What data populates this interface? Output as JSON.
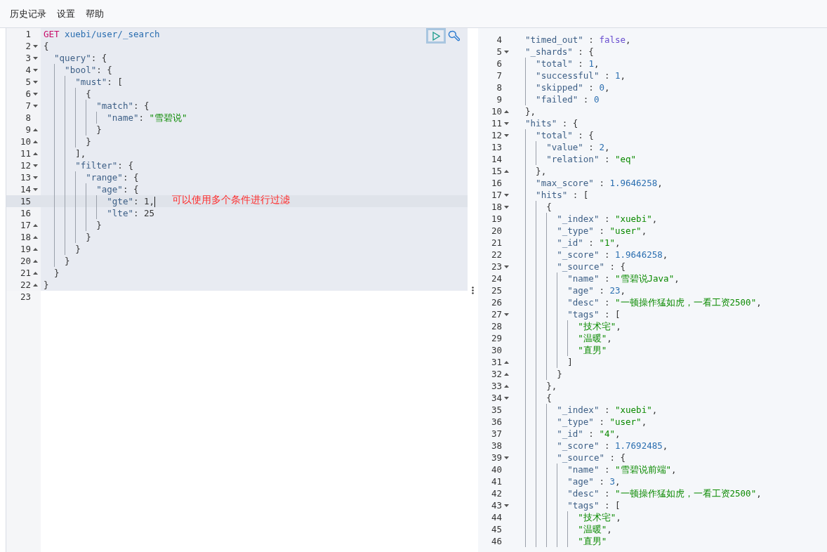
{
  "menu": [
    {
      "label": "历史记录"
    },
    {
      "label": "设置"
    },
    {
      "label": "帮助"
    }
  ],
  "request_editor": {
    "lines": [
      {
        "n": "1",
        "fold_start": false,
        "fold_end": false,
        "highlighted": true,
        "active": false,
        "segs": [
          {
            "kind": "method",
            "text": "GET"
          },
          {
            "kind": "path",
            "text": " xuebi/user/_search"
          }
        ]
      },
      {
        "n": "2",
        "fold_start": true,
        "fold_end": false,
        "highlighted": true,
        "active": false,
        "segs": [
          {
            "kind": "punct",
            "text": "{"
          }
        ]
      },
      {
        "n": "3",
        "fold_start": true,
        "fold_end": false,
        "highlighted": true,
        "active": false,
        "segs": [
          {
            "kind": "key",
            "text": "  \"query\""
          },
          {
            "kind": "punct",
            "text": ": {"
          }
        ]
      },
      {
        "n": "4",
        "fold_start": true,
        "fold_end": false,
        "highlighted": true,
        "active": false,
        "segs": [
          {
            "kind": "key",
            "text": "    \"bool\""
          },
          {
            "kind": "punct",
            "text": ": {"
          }
        ]
      },
      {
        "n": "5",
        "fold_start": true,
        "fold_end": false,
        "highlighted": true,
        "active": false,
        "segs": [
          {
            "kind": "key",
            "text": "      \"must\""
          },
          {
            "kind": "punct",
            "text": ": ["
          }
        ]
      },
      {
        "n": "6",
        "fold_start": true,
        "fold_end": false,
        "highlighted": true,
        "active": false,
        "segs": [
          {
            "kind": "punct",
            "text": "        {"
          }
        ]
      },
      {
        "n": "7",
        "fold_start": true,
        "fold_end": false,
        "highlighted": true,
        "active": false,
        "segs": [
          {
            "kind": "key",
            "text": "          \"match\""
          },
          {
            "kind": "punct",
            "text": ": {"
          }
        ]
      },
      {
        "n": "8",
        "fold_start": false,
        "fold_end": false,
        "highlighted": true,
        "active": false,
        "segs": [
          {
            "kind": "key",
            "text": "            \"name\""
          },
          {
            "kind": "punct",
            "text": ": "
          },
          {
            "kind": "string",
            "text": "\"雪碧说\""
          }
        ]
      },
      {
        "n": "9",
        "fold_start": false,
        "fold_end": true,
        "highlighted": true,
        "active": false,
        "segs": [
          {
            "kind": "punct",
            "text": "          }"
          }
        ]
      },
      {
        "n": "10",
        "fold_start": false,
        "fold_end": true,
        "highlighted": true,
        "active": false,
        "segs": [
          {
            "kind": "punct",
            "text": "        }"
          }
        ]
      },
      {
        "n": "11",
        "fold_start": false,
        "fold_end": true,
        "highlighted": true,
        "active": false,
        "segs": [
          {
            "kind": "punct",
            "text": "      ],"
          }
        ]
      },
      {
        "n": "12",
        "fold_start": true,
        "fold_end": false,
        "highlighted": true,
        "active": false,
        "segs": [
          {
            "kind": "key",
            "text": "      \"filter\""
          },
          {
            "kind": "punct",
            "text": ": {"
          }
        ]
      },
      {
        "n": "13",
        "fold_start": true,
        "fold_end": false,
        "highlighted": true,
        "active": false,
        "segs": [
          {
            "kind": "key",
            "text": "        \"range\""
          },
          {
            "kind": "punct",
            "text": ": {"
          }
        ]
      },
      {
        "n": "14",
        "fold_start": true,
        "fold_end": false,
        "highlighted": true,
        "active": false,
        "segs": [
          {
            "kind": "key",
            "text": "          \"age\""
          },
          {
            "kind": "punct",
            "text": ": {"
          }
        ]
      },
      {
        "n": "15",
        "fold_start": false,
        "fold_end": false,
        "highlighted": true,
        "active": true,
        "segs": [
          {
            "kind": "key",
            "text": "            \"gte\""
          },
          {
            "kind": "punct",
            "text": ": 1,"
          }
        ],
        "note": "可以使用多个条件进行过滤"
      },
      {
        "n": "16",
        "fold_start": false,
        "fold_end": false,
        "highlighted": true,
        "active": false,
        "segs": [
          {
            "kind": "key",
            "text": "            \"lte\""
          },
          {
            "kind": "punct",
            "text": ": 25"
          }
        ]
      },
      {
        "n": "17",
        "fold_start": false,
        "fold_end": true,
        "highlighted": true,
        "active": false,
        "segs": [
          {
            "kind": "punct",
            "text": "          }"
          }
        ]
      },
      {
        "n": "18",
        "fold_start": false,
        "fold_end": true,
        "highlighted": true,
        "active": false,
        "segs": [
          {
            "kind": "punct",
            "text": "        }"
          }
        ]
      },
      {
        "n": "19",
        "fold_start": false,
        "fold_end": true,
        "highlighted": true,
        "active": false,
        "segs": [
          {
            "kind": "punct",
            "text": "      }"
          }
        ]
      },
      {
        "n": "20",
        "fold_start": false,
        "fold_end": true,
        "highlighted": true,
        "active": false,
        "segs": [
          {
            "kind": "punct",
            "text": "    }"
          }
        ]
      },
      {
        "n": "21",
        "fold_start": false,
        "fold_end": true,
        "highlighted": true,
        "active": false,
        "segs": [
          {
            "kind": "punct",
            "text": "  }"
          }
        ]
      },
      {
        "n": "22",
        "fold_start": false,
        "fold_end": true,
        "highlighted": true,
        "active": false,
        "segs": [
          {
            "kind": "punct",
            "text": "}"
          }
        ]
      },
      {
        "n": "23",
        "fold_start": false,
        "fold_end": false,
        "highlighted": false,
        "active": false
      }
    ]
  },
  "response_viewer": {
    "lines": [
      {
        "n": "4",
        "fold_start": false,
        "fold_end": false,
        "segs": [
          {
            "kind": "key",
            "text": "  \"timed_out\""
          },
          {
            "kind": "punct",
            "text": " : "
          },
          {
            "kind": "bool",
            "text": "false"
          },
          {
            "kind": "punct",
            "text": ","
          }
        ]
      },
      {
        "n": "5",
        "fold_start": true,
        "fold_end": false,
        "segs": [
          {
            "kind": "key",
            "text": "  \"_shards\""
          },
          {
            "kind": "punct",
            "text": " : {"
          }
        ]
      },
      {
        "n": "6",
        "fold_start": false,
        "fold_end": false,
        "segs": [
          {
            "kind": "key",
            "text": "    \"total\""
          },
          {
            "kind": "punct",
            "text": " : "
          },
          {
            "kind": "number",
            "text": "1"
          },
          {
            "kind": "punct",
            "text": ","
          }
        ]
      },
      {
        "n": "7",
        "fold_start": false,
        "fold_end": false,
        "segs": [
          {
            "kind": "key",
            "text": "    \"successful\""
          },
          {
            "kind": "punct",
            "text": " : "
          },
          {
            "kind": "number",
            "text": "1"
          },
          {
            "kind": "punct",
            "text": ","
          }
        ]
      },
      {
        "n": "8",
        "fold_start": false,
        "fold_end": false,
        "segs": [
          {
            "kind": "key",
            "text": "    \"skipped\""
          },
          {
            "kind": "punct",
            "text": " : "
          },
          {
            "kind": "number",
            "text": "0"
          },
          {
            "kind": "punct",
            "text": ","
          }
        ]
      },
      {
        "n": "9",
        "fold_start": false,
        "fold_end": false,
        "segs": [
          {
            "kind": "key",
            "text": "    \"failed\""
          },
          {
            "kind": "punct",
            "text": " : "
          },
          {
            "kind": "number",
            "text": "0"
          }
        ]
      },
      {
        "n": "10",
        "fold_start": false,
        "fold_end": true,
        "segs": [
          {
            "kind": "punct",
            "text": "  },"
          }
        ]
      },
      {
        "n": "11",
        "fold_start": true,
        "fold_end": false,
        "segs": [
          {
            "kind": "key",
            "text": "  \"hits\""
          },
          {
            "kind": "punct",
            "text": " : {"
          }
        ]
      },
      {
        "n": "12",
        "fold_start": true,
        "fold_end": false,
        "segs": [
          {
            "kind": "key",
            "text": "    \"total\""
          },
          {
            "kind": "punct",
            "text": " : {"
          }
        ]
      },
      {
        "n": "13",
        "fold_start": false,
        "fold_end": false,
        "segs": [
          {
            "kind": "key",
            "text": "      \"value\""
          },
          {
            "kind": "punct",
            "text": " : "
          },
          {
            "kind": "number",
            "text": "2"
          },
          {
            "kind": "punct",
            "text": ","
          }
        ]
      },
      {
        "n": "14",
        "fold_start": false,
        "fold_end": false,
        "segs": [
          {
            "kind": "key",
            "text": "      \"relation\""
          },
          {
            "kind": "punct",
            "text": " : "
          },
          {
            "kind": "string",
            "text": "\"eq\""
          }
        ]
      },
      {
        "n": "15",
        "fold_start": false,
        "fold_end": true,
        "segs": [
          {
            "kind": "punct",
            "text": "    },"
          }
        ]
      },
      {
        "n": "16",
        "fold_start": false,
        "fold_end": false,
        "segs": [
          {
            "kind": "key",
            "text": "    \"max_score\""
          },
          {
            "kind": "punct",
            "text": " : "
          },
          {
            "kind": "number",
            "text": "1.9646258"
          },
          {
            "kind": "punct",
            "text": ","
          }
        ]
      },
      {
        "n": "17",
        "fold_start": true,
        "fold_end": false,
        "segs": [
          {
            "kind": "key",
            "text": "    \"hits\""
          },
          {
            "kind": "punct",
            "text": " : ["
          }
        ]
      },
      {
        "n": "18",
        "fold_start": true,
        "fold_end": false,
        "segs": [
          {
            "kind": "punct",
            "text": "      {"
          }
        ]
      },
      {
        "n": "19",
        "fold_start": false,
        "fold_end": false,
        "segs": [
          {
            "kind": "key",
            "text": "        \"_index\""
          },
          {
            "kind": "punct",
            "text": " : "
          },
          {
            "kind": "string",
            "text": "\"xuebi\""
          },
          {
            "kind": "punct",
            "text": ","
          }
        ]
      },
      {
        "n": "20",
        "fold_start": false,
        "fold_end": false,
        "segs": [
          {
            "kind": "key",
            "text": "        \"_type\""
          },
          {
            "kind": "punct",
            "text": " : "
          },
          {
            "kind": "string",
            "text": "\"user\""
          },
          {
            "kind": "punct",
            "text": ","
          }
        ]
      },
      {
        "n": "21",
        "fold_start": false,
        "fold_end": false,
        "segs": [
          {
            "kind": "key",
            "text": "        \"_id\""
          },
          {
            "kind": "punct",
            "text": " : "
          },
          {
            "kind": "string",
            "text": "\"1\""
          },
          {
            "kind": "punct",
            "text": ","
          }
        ]
      },
      {
        "n": "22",
        "fold_start": false,
        "fold_end": false,
        "segs": [
          {
            "kind": "key",
            "text": "        \"_score\""
          },
          {
            "kind": "punct",
            "text": " : "
          },
          {
            "kind": "number",
            "text": "1.9646258"
          },
          {
            "kind": "punct",
            "text": ","
          }
        ]
      },
      {
        "n": "23",
        "fold_start": true,
        "fold_end": false,
        "segs": [
          {
            "kind": "key",
            "text": "        \"_source\""
          },
          {
            "kind": "punct",
            "text": " : {"
          }
        ]
      },
      {
        "n": "24",
        "fold_start": false,
        "fold_end": false,
        "segs": [
          {
            "kind": "key",
            "text": "          \"name\""
          },
          {
            "kind": "punct",
            "text": " : "
          },
          {
            "kind": "string",
            "text": "\"雪碧说Java\""
          },
          {
            "kind": "punct",
            "text": ","
          }
        ]
      },
      {
        "n": "25",
        "fold_start": false,
        "fold_end": false,
        "segs": [
          {
            "kind": "key",
            "text": "          \"age\""
          },
          {
            "kind": "punct",
            "text": " : "
          },
          {
            "kind": "number",
            "text": "23"
          },
          {
            "kind": "punct",
            "text": ","
          }
        ]
      },
      {
        "n": "26",
        "fold_start": false,
        "fold_end": false,
        "segs": [
          {
            "kind": "key",
            "text": "          \"desc\""
          },
          {
            "kind": "punct",
            "text": " : "
          },
          {
            "kind": "string",
            "text": "\"一顿操作猛如虎，一看工资2500\""
          },
          {
            "kind": "punct",
            "text": ","
          }
        ]
      },
      {
        "n": "27",
        "fold_start": true,
        "fold_end": false,
        "segs": [
          {
            "kind": "key",
            "text": "          \"tags\""
          },
          {
            "kind": "punct",
            "text": " : ["
          }
        ]
      },
      {
        "n": "28",
        "fold_start": false,
        "fold_end": false,
        "segs": [
          {
            "kind": "string",
            "text": "            \"技术宅\""
          },
          {
            "kind": "punct",
            "text": ","
          }
        ]
      },
      {
        "n": "29",
        "fold_start": false,
        "fold_end": false,
        "segs": [
          {
            "kind": "string",
            "text": "            \"温暖\""
          },
          {
            "kind": "punct",
            "text": ","
          }
        ]
      },
      {
        "n": "30",
        "fold_start": false,
        "fold_end": false,
        "segs": [
          {
            "kind": "string",
            "text": "            \"直男\""
          }
        ]
      },
      {
        "n": "31",
        "fold_start": false,
        "fold_end": true,
        "segs": [
          {
            "kind": "punct",
            "text": "          ]"
          }
        ]
      },
      {
        "n": "32",
        "fold_start": false,
        "fold_end": true,
        "segs": [
          {
            "kind": "punct",
            "text": "        }"
          }
        ]
      },
      {
        "n": "33",
        "fold_start": false,
        "fold_end": true,
        "segs": [
          {
            "kind": "punct",
            "text": "      },"
          }
        ]
      },
      {
        "n": "34",
        "fold_start": true,
        "fold_end": false,
        "segs": [
          {
            "kind": "punct",
            "text": "      {"
          }
        ]
      },
      {
        "n": "35",
        "fold_start": false,
        "fold_end": false,
        "segs": [
          {
            "kind": "key",
            "text": "        \"_index\""
          },
          {
            "kind": "punct",
            "text": " : "
          },
          {
            "kind": "string",
            "text": "\"xuebi\""
          },
          {
            "kind": "punct",
            "text": ","
          }
        ]
      },
      {
        "n": "36",
        "fold_start": false,
        "fold_end": false,
        "segs": [
          {
            "kind": "key",
            "text": "        \"_type\""
          },
          {
            "kind": "punct",
            "text": " : "
          },
          {
            "kind": "string",
            "text": "\"user\""
          },
          {
            "kind": "punct",
            "text": ","
          }
        ]
      },
      {
        "n": "37",
        "fold_start": false,
        "fold_end": false,
        "segs": [
          {
            "kind": "key",
            "text": "        \"_id\""
          },
          {
            "kind": "punct",
            "text": " : "
          },
          {
            "kind": "string",
            "text": "\"4\""
          },
          {
            "kind": "punct",
            "text": ","
          }
        ]
      },
      {
        "n": "38",
        "fold_start": false,
        "fold_end": false,
        "segs": [
          {
            "kind": "key",
            "text": "        \"_score\""
          },
          {
            "kind": "punct",
            "text": " : "
          },
          {
            "kind": "number",
            "text": "1.7692485"
          },
          {
            "kind": "punct",
            "text": ","
          }
        ]
      },
      {
        "n": "39",
        "fold_start": true,
        "fold_end": false,
        "segs": [
          {
            "kind": "key",
            "text": "        \"_source\""
          },
          {
            "kind": "punct",
            "text": " : {"
          }
        ]
      },
      {
        "n": "40",
        "fold_start": false,
        "fold_end": false,
        "segs": [
          {
            "kind": "key",
            "text": "          \"name\""
          },
          {
            "kind": "punct",
            "text": " : "
          },
          {
            "kind": "string",
            "text": "\"雪碧说前端\""
          },
          {
            "kind": "punct",
            "text": ","
          }
        ]
      },
      {
        "n": "41",
        "fold_start": false,
        "fold_end": false,
        "segs": [
          {
            "kind": "key",
            "text": "          \"age\""
          },
          {
            "kind": "punct",
            "text": " : "
          },
          {
            "kind": "number",
            "text": "3"
          },
          {
            "kind": "punct",
            "text": ","
          }
        ]
      },
      {
        "n": "42",
        "fold_start": false,
        "fold_end": false,
        "segs": [
          {
            "kind": "key",
            "text": "          \"desc\""
          },
          {
            "kind": "punct",
            "text": " : "
          },
          {
            "kind": "string",
            "text": "\"一顿操作猛如虎，一看工资2500\""
          },
          {
            "kind": "punct",
            "text": ","
          }
        ]
      },
      {
        "n": "43",
        "fold_start": true,
        "fold_end": false,
        "segs": [
          {
            "kind": "key",
            "text": "          \"tags\""
          },
          {
            "kind": "punct",
            "text": " : ["
          }
        ]
      },
      {
        "n": "44",
        "fold_start": false,
        "fold_end": false,
        "segs": [
          {
            "kind": "string",
            "text": "            \"技术宅\""
          },
          {
            "kind": "punct",
            "text": ","
          }
        ]
      },
      {
        "n": "45",
        "fold_start": false,
        "fold_end": false,
        "segs": [
          {
            "kind": "string",
            "text": "            \"温暖\""
          },
          {
            "kind": "punct",
            "text": ","
          }
        ]
      },
      {
        "n": "46",
        "fold_start": false,
        "fold_end": false,
        "segs": [
          {
            "kind": "string",
            "text": "            \"直男\""
          }
        ]
      }
    ]
  }
}
